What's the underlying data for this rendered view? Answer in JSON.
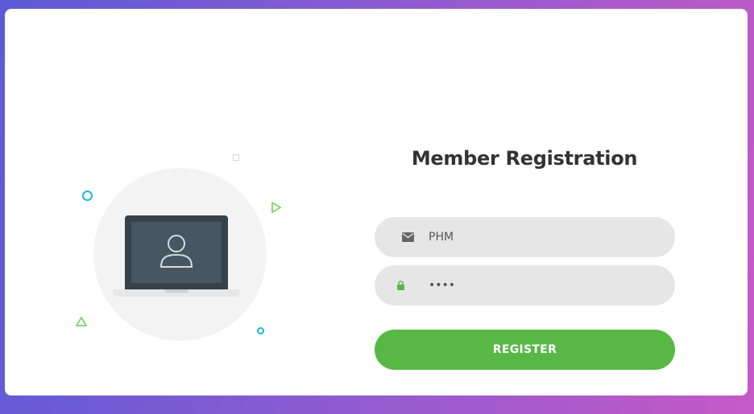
{
  "form": {
    "title": "Member Registration",
    "email": {
      "value": "PHM",
      "icon": "envelope-icon"
    },
    "password": {
      "value": "1234",
      "icon": "lock-icon"
    },
    "submit_label": "REGISTER"
  },
  "illustration": {
    "icon": "laptop-user-icon"
  },
  "colors": {
    "accent": "#57b846",
    "input_bg": "#e6e6e6",
    "title": "#333333",
    "decor_cyan": "#1fb8d8",
    "decor_green": "#7dd46a",
    "laptop_screen": "#465763"
  }
}
